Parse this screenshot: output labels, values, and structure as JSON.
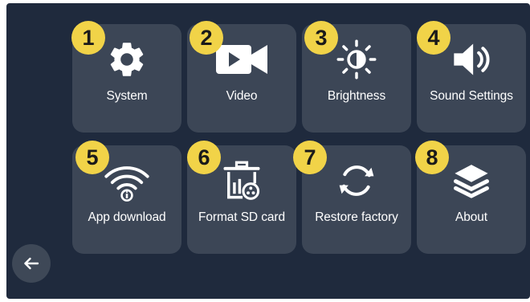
{
  "menu": {
    "items": [
      {
        "number": "1",
        "label": "System",
        "icon": "gear-icon"
      },
      {
        "number": "2",
        "label": "Video",
        "icon": "video-camera-icon"
      },
      {
        "number": "3",
        "label": "Brightness",
        "icon": "brightness-icon"
      },
      {
        "number": "4",
        "label": "Sound Settings",
        "icon": "speaker-icon"
      },
      {
        "number": "5",
        "label": "App download",
        "icon": "wifi-info-icon"
      },
      {
        "number": "6",
        "label": "Format SD card",
        "icon": "format-sd-icon"
      },
      {
        "number": "7",
        "label": "Restore factory",
        "icon": "refresh-icon"
      },
      {
        "number": "8",
        "label": "About",
        "icon": "layers-icon"
      }
    ]
  },
  "navigation": {
    "back_icon": "arrow-left-icon"
  },
  "colors": {
    "screen_background": "#1f2a3d",
    "tile_background": "#3c4656",
    "badge_fill": "#f1d348",
    "icon_color": "#ffffff"
  }
}
